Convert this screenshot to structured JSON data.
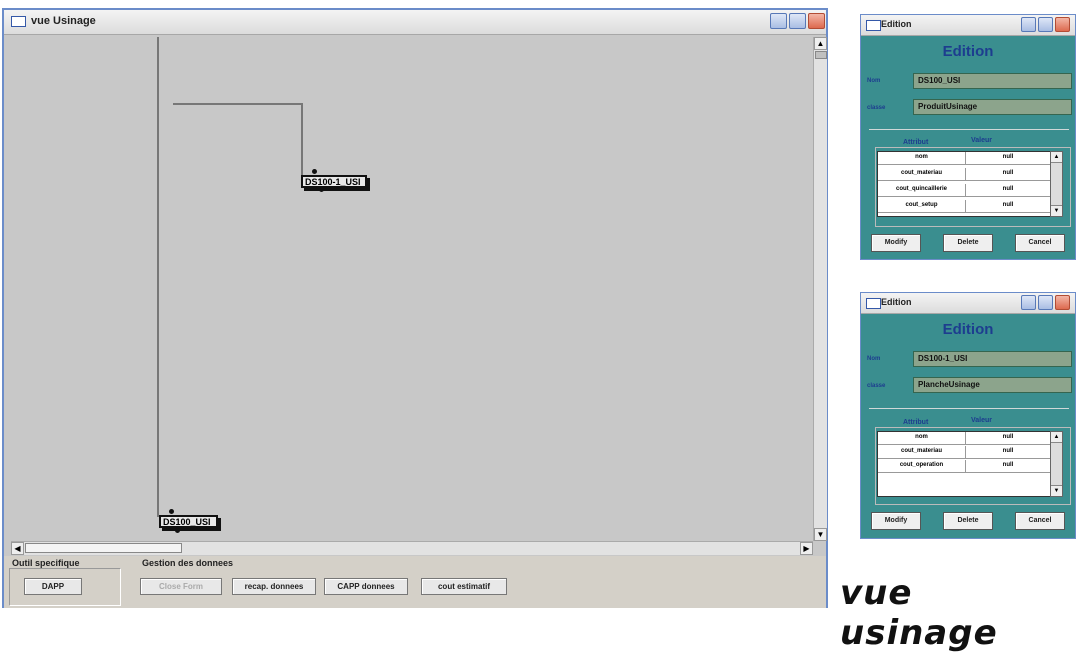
{
  "main_window": {
    "title": "vue Usinage",
    "nodes": [
      {
        "label": "DS100-1_USI"
      },
      {
        "label": "DS100_USI"
      }
    ]
  },
  "bottom_panel": {
    "outil_label": "Outil specifique",
    "gestion_label": "Gestion des donnees",
    "buttons": {
      "dapp": "DAPP",
      "close_form": "Close Form",
      "recap": "recap. donnees",
      "capp": "CAPP donnees",
      "cout": "cout estimatif"
    }
  },
  "dialogs": [
    {
      "title": "Edition",
      "heading": "Edition",
      "nom_label": "Nom",
      "nom_value": "DS100_USI",
      "classe_label": "classe",
      "classe_value": "ProduitUsinage",
      "attr_header": "Attribut",
      "val_header": "Valeur",
      "rows": [
        {
          "attr": "nom",
          "val": "null"
        },
        {
          "attr": "cout_materiau",
          "val": "null"
        },
        {
          "attr": "cout_quincaillerie",
          "val": "null"
        },
        {
          "attr": "cout_setup",
          "val": "null"
        }
      ],
      "modify": "Modify",
      "delete": "Delete",
      "cancel": "Cancel"
    },
    {
      "title": "Edition",
      "heading": "Edition",
      "nom_label": "Nom",
      "nom_value": "DS100-1_USI",
      "classe_label": "classe",
      "classe_value": "PlancheUsinage",
      "attr_header": "Attribut",
      "val_header": "Valeur",
      "rows": [
        {
          "attr": "nom",
          "val": "null"
        },
        {
          "attr": "cout_materiau",
          "val": "null"
        },
        {
          "attr": "cout_operation",
          "val": "null"
        }
      ],
      "modify": "Modify",
      "delete": "Delete",
      "cancel": "Cancel"
    }
  ],
  "caption": "vue usinage"
}
